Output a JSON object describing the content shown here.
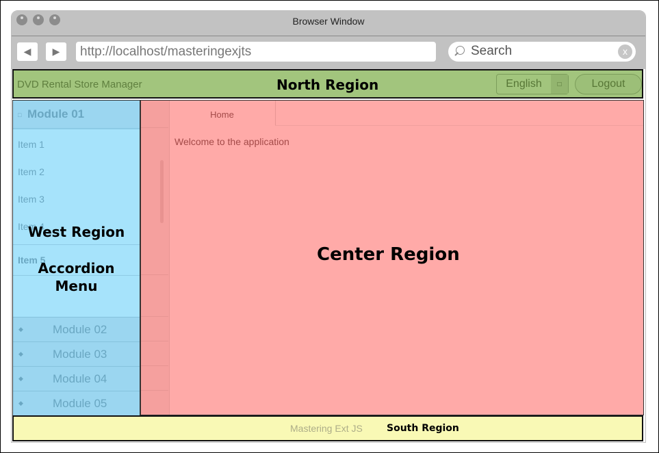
{
  "window": {
    "title": "Browser Window",
    "back_icon": "◀",
    "forward_icon": "▶",
    "url": "http://localhost/masteringexjts",
    "search_placeholder": "Search",
    "search_clear": "x"
  },
  "north": {
    "app_title": "DVD Rental Store Manager",
    "region_label": "North Region",
    "language": "English",
    "language_trigger": "□",
    "logout_label": "Logout"
  },
  "west": {
    "region_label": "West Region",
    "accordion_label_1": "Accordion",
    "accordion_label_2": "Menu",
    "active_module": {
      "icon": "□",
      "label": "Module 01"
    },
    "items": [
      "Item 1",
      "Item 2",
      "Item 3",
      "Item 4",
      "Item 5"
    ],
    "modules": [
      {
        "icon": "◆",
        "label": "Module 02"
      },
      {
        "icon": "◆",
        "label": "Module 03"
      },
      {
        "icon": "◆",
        "label": "Module 04"
      },
      {
        "icon": "◆",
        "label": "Module 05"
      }
    ]
  },
  "center": {
    "tab_label": "Home",
    "welcome_text": "Welcome to the application",
    "region_label": "Center Region"
  },
  "south": {
    "text": "Mastering Ext JS",
    "region_label": "South Region"
  },
  "colors": {
    "north": "#a2c57d",
    "west": "#a6e3fb",
    "center": "#ffaaa8",
    "south": "#f9f9b5"
  }
}
